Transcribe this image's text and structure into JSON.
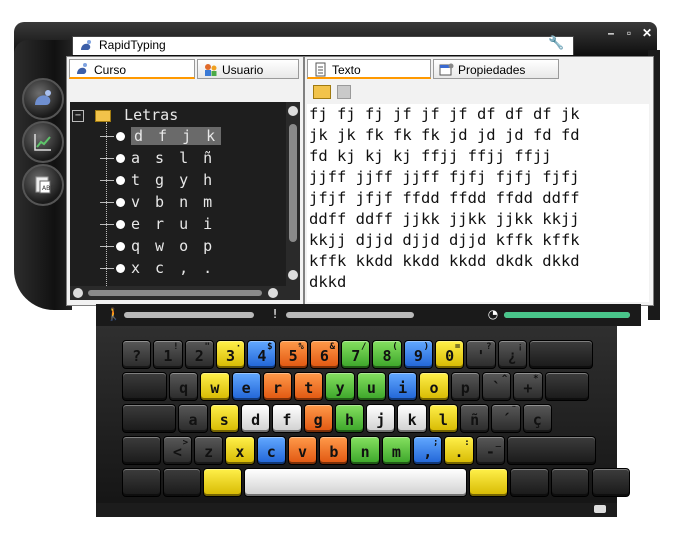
{
  "window": {
    "title": "RapidTyping",
    "help_label": "?",
    "tools_icon": "wrench-icon",
    "minimize_label": "–",
    "maximize_label": "▫",
    "close_label": "✕"
  },
  "sidebar": {
    "buttons": [
      {
        "name": "typing-mode-icon"
      },
      {
        "name": "statistics-chart-icon"
      },
      {
        "name": "lesson-editor-icon"
      }
    ]
  },
  "left_panel": {
    "tabs": [
      {
        "label": "Curso",
        "active": true,
        "icon": "course-icon"
      },
      {
        "label": "Usuario",
        "active": false,
        "icon": "users-icon"
      }
    ],
    "tree": {
      "root_label": "Letras",
      "root_toggle": "−",
      "items": [
        {
          "label": "d f j k",
          "selected": true
        },
        {
          "label": "a s l ñ",
          "selected": false
        },
        {
          "label": "t g y h",
          "selected": false
        },
        {
          "label": "v b n m",
          "selected": false
        },
        {
          "label": "e r u i",
          "selected": false
        },
        {
          "label": "q w o p",
          "selected": false
        },
        {
          "label": "x c , .",
          "selected": false
        }
      ]
    }
  },
  "right_panel": {
    "tabs": [
      {
        "label": "Texto",
        "active": true,
        "icon": "text-document-icon"
      },
      {
        "label": "Propiedades",
        "active": false,
        "icon": "properties-icon"
      }
    ],
    "toolbar": {
      "open_icon": "open-folder-icon",
      "save_icon": "save-disk-icon"
    },
    "lines": [
      "fj fj fj jf jf jf df df df jk",
      "jk jk fk fk fk jd jd jd fd fd",
      "fd kj kj kj ffjj ffjj ffjj",
      "jjff jjff jjff fjfj fjfj fjfj",
      "jfjf jfjf ffdd ffdd ffdd ddff",
      "ddff ddff jjkk jjkk jjkk kkjj",
      "kkjj djjd djjd djjd kffk kffk",
      "kffk kkdd kkdd kkdd dkdk dkkd",
      "dkkd"
    ]
  },
  "status": {
    "progress_fraction": 0,
    "errors_fraction": 0,
    "time_fraction": 1,
    "accent_color": "#49c48a"
  },
  "keyboard": {
    "rows": [
      [
        {
          "main": "?",
          "shift": "",
          "color": "gray",
          "w": 1
        },
        {
          "main": "1",
          "shift": "!",
          "color": "gray",
          "w": 1
        },
        {
          "main": "2",
          "shift": "\"",
          "color": "gray",
          "w": 1
        },
        {
          "main": "3",
          "shift": "·",
          "color": "yellow",
          "w": 1
        },
        {
          "main": "4",
          "shift": "$",
          "color": "blue",
          "w": 1
        },
        {
          "main": "5",
          "shift": "%",
          "color": "orange",
          "w": 1
        },
        {
          "main": "6",
          "shift": "&",
          "color": "orange",
          "w": 1
        },
        {
          "main": "7",
          "shift": "/",
          "color": "green",
          "w": 1
        },
        {
          "main": "8",
          "shift": "(",
          "color": "green",
          "w": 1
        },
        {
          "main": "9",
          "shift": ")",
          "color": "blue",
          "w": 1
        },
        {
          "main": "0",
          "shift": "=",
          "color": "yellow",
          "w": 1
        },
        {
          "main": "'",
          "shift": "?",
          "color": "gray",
          "w": 1
        },
        {
          "main": "¿",
          "shift": "¡",
          "color": "gray",
          "w": 1
        },
        {
          "main": "",
          "shift": "",
          "color": "dark",
          "w": 2.1
        }
      ],
      [
        {
          "main": "",
          "shift": "",
          "color": "dark",
          "w": 1.5
        },
        {
          "main": "q",
          "shift": "",
          "color": "gray",
          "w": 1
        },
        {
          "main": "w",
          "shift": "",
          "color": "yellow",
          "w": 1
        },
        {
          "main": "e",
          "shift": "",
          "color": "blue",
          "w": 1
        },
        {
          "main": "r",
          "shift": "",
          "color": "orange",
          "w": 1
        },
        {
          "main": "t",
          "shift": "",
          "color": "orange",
          "w": 1
        },
        {
          "main": "y",
          "shift": "",
          "color": "green",
          "w": 1
        },
        {
          "main": "u",
          "shift": "",
          "color": "green",
          "w": 1
        },
        {
          "main": "i",
          "shift": "",
          "color": "blue",
          "w": 1
        },
        {
          "main": "o",
          "shift": "",
          "color": "yellow",
          "w": 1
        },
        {
          "main": "p",
          "shift": "",
          "color": "gray",
          "w": 1
        },
        {
          "main": "`",
          "shift": "^",
          "color": "gray",
          "w": 1
        },
        {
          "main": "+",
          "shift": "*",
          "color": "gray",
          "w": 1
        },
        {
          "main": "",
          "shift": "",
          "color": "dark",
          "w": 1.5
        }
      ],
      [
        {
          "main": "",
          "shift": "",
          "color": "dark",
          "w": 1.8
        },
        {
          "main": "a",
          "shift": "",
          "color": "gray",
          "w": 1
        },
        {
          "main": "s",
          "shift": "",
          "color": "yellow",
          "w": 1
        },
        {
          "main": "d",
          "shift": "",
          "color": "white",
          "w": 1
        },
        {
          "main": "f",
          "shift": "",
          "color": "white",
          "w": 1
        },
        {
          "main": "g",
          "shift": "",
          "color": "orange",
          "w": 1
        },
        {
          "main": "h",
          "shift": "",
          "color": "green",
          "w": 1
        },
        {
          "main": "j",
          "shift": "",
          "color": "white",
          "w": 1
        },
        {
          "main": "k",
          "shift": "",
          "color": "white",
          "w": 1
        },
        {
          "main": "l",
          "shift": "",
          "color": "yellow",
          "w": 1
        },
        {
          "main": "ñ",
          "shift": "",
          "color": "gray",
          "w": 1
        },
        {
          "main": "´",
          "shift": "¨",
          "color": "gray",
          "w": 1
        },
        {
          "main": "ç",
          "shift": "",
          "color": "gray",
          "w": 1
        }
      ],
      [
        {
          "main": "",
          "shift": "",
          "color": "dark",
          "w": 1.3
        },
        {
          "main": "<",
          "shift": ">",
          "color": "gray",
          "w": 1
        },
        {
          "main": "z",
          "shift": "",
          "color": "gray",
          "w": 1
        },
        {
          "main": "x",
          "shift": "",
          "color": "yellow",
          "w": 1
        },
        {
          "main": "c",
          "shift": "",
          "color": "blue",
          "w": 1
        },
        {
          "main": "v",
          "shift": "",
          "color": "orange",
          "w": 1
        },
        {
          "main": "b",
          "shift": "",
          "color": "orange",
          "w": 1
        },
        {
          "main": "n",
          "shift": "",
          "color": "green",
          "w": 1
        },
        {
          "main": "m",
          "shift": "",
          "color": "green",
          "w": 1
        },
        {
          "main": ",",
          "shift": ";",
          "color": "blue",
          "w": 1
        },
        {
          "main": ".",
          "shift": ":",
          "color": "yellow",
          "w": 1
        },
        {
          "main": "-",
          "shift": "_",
          "color": "gray",
          "w": 1
        },
        {
          "main": "",
          "shift": "",
          "color": "dark",
          "w": 2.9
        }
      ],
      [
        {
          "main": "",
          "shift": "",
          "color": "dark",
          "w": 1.3
        },
        {
          "main": "",
          "shift": "",
          "color": "dark",
          "w": 1.3
        },
        {
          "main": "",
          "shift": "",
          "color": "yellow",
          "w": 1.3
        },
        {
          "main": "",
          "shift": "",
          "color": "white",
          "w": 7.2
        },
        {
          "main": "",
          "shift": "",
          "color": "yellow",
          "w": 1.3
        },
        {
          "main": "",
          "shift": "",
          "color": "dark",
          "w": 1.3
        },
        {
          "main": "",
          "shift": "",
          "color": "dark",
          "w": 1.3
        },
        {
          "main": "",
          "shift": "",
          "color": "dark",
          "w": 1.3
        }
      ]
    ]
  }
}
